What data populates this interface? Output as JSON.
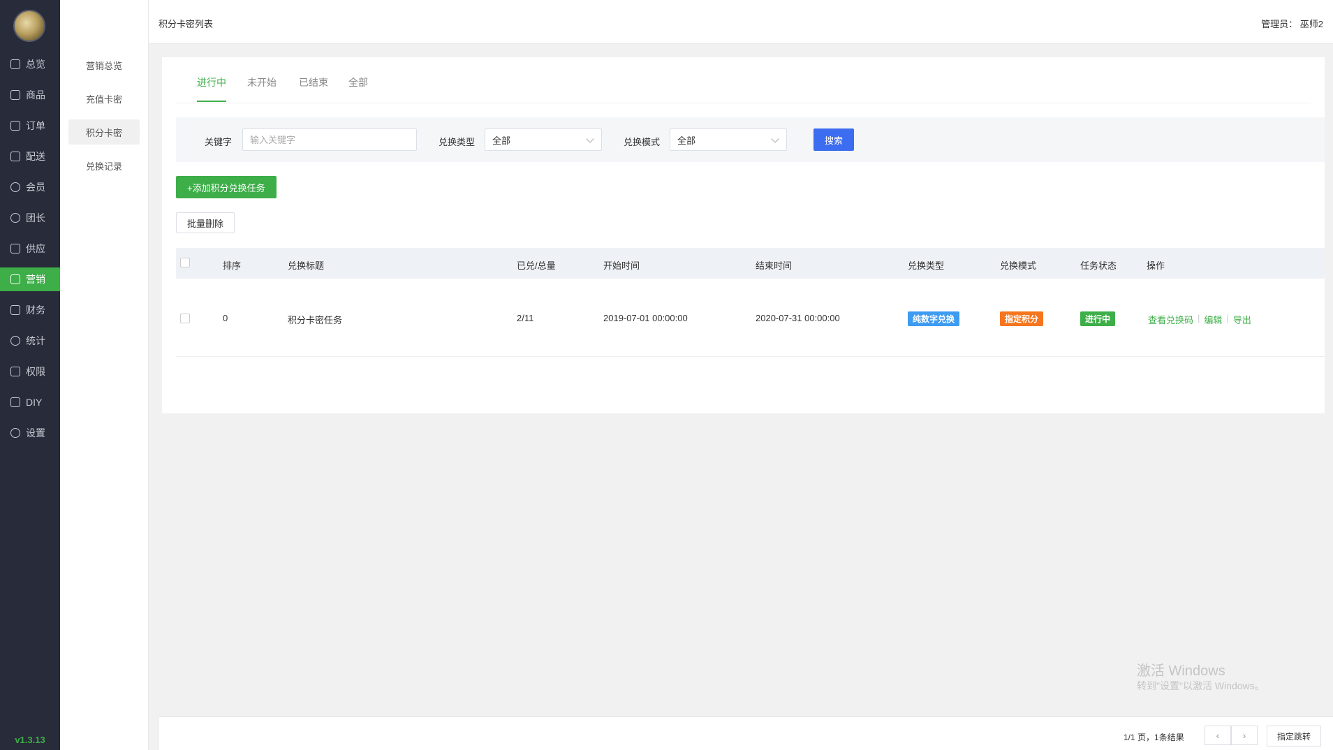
{
  "sidebar": {
    "version": "v1.3.13",
    "items": [
      {
        "label": "总览",
        "icon": "home-icon"
      },
      {
        "label": "商品",
        "icon": "product-icon"
      },
      {
        "label": "订单",
        "icon": "order-icon"
      },
      {
        "label": "配送",
        "icon": "delivery-icon"
      },
      {
        "label": "会员",
        "icon": "user-icon"
      },
      {
        "label": "团长",
        "icon": "leader-icon"
      },
      {
        "label": "供应",
        "icon": "supply-icon"
      },
      {
        "label": "营销",
        "icon": "gift-icon"
      },
      {
        "label": "财务",
        "icon": "finance-icon"
      },
      {
        "label": "统计",
        "icon": "chart-icon"
      },
      {
        "label": "权限",
        "icon": "shield-icon"
      },
      {
        "label": "DIY",
        "icon": "layout-icon"
      },
      {
        "label": "设置",
        "icon": "gear-icon"
      }
    ]
  },
  "subnav": {
    "items": [
      "营销总览",
      "充值卡密",
      "积分卡密",
      "兑换记录"
    ]
  },
  "header": {
    "title": "积分卡密列表",
    "admin": "管理员： 巫师2"
  },
  "tabs": [
    "进行中",
    "未开始",
    "已结束",
    "全部"
  ],
  "filter": {
    "keyword_label": "关键字",
    "keyword_placeholder": "输入关键字",
    "type_label": "兑换类型",
    "type_value": "全部",
    "mode_label": "兑换模式",
    "mode_value": "全部",
    "search": "搜索"
  },
  "actions": {
    "add": "+添加积分兑换任务",
    "batch_delete": "批量删除"
  },
  "table": {
    "headers": [
      "排序",
      "兑换标题",
      "已兑/总量",
      "开始时间",
      "结束时间",
      "兑换类型",
      "兑换模式",
      "任务状态",
      "操作"
    ],
    "rows": [
      {
        "sort": "0",
        "title": "积分卡密任务",
        "redeemed": "2/11",
        "start": "2019-07-01 00:00:00",
        "end": "2020-07-31 00:00:00",
        "type": "纯数字兑换",
        "mode": "指定积分",
        "status": "进行中",
        "ops": [
          "查看兑换码",
          "编辑",
          "导出"
        ]
      }
    ]
  },
  "watermark": {
    "line1": "激活 Windows",
    "line2": "转到\"设置\"以激活 Windows。"
  },
  "pager": {
    "summary": "1/1 页，1条结果",
    "prev": "‹",
    "next": "›",
    "jump": "指定跳转"
  },
  "colors": {
    "green": "#3dae48",
    "blue": "#3c6df0",
    "badge_blue": "#3d9bf2",
    "badge_orange": "#f5761e",
    "sidebar_bg": "#282b39"
  }
}
